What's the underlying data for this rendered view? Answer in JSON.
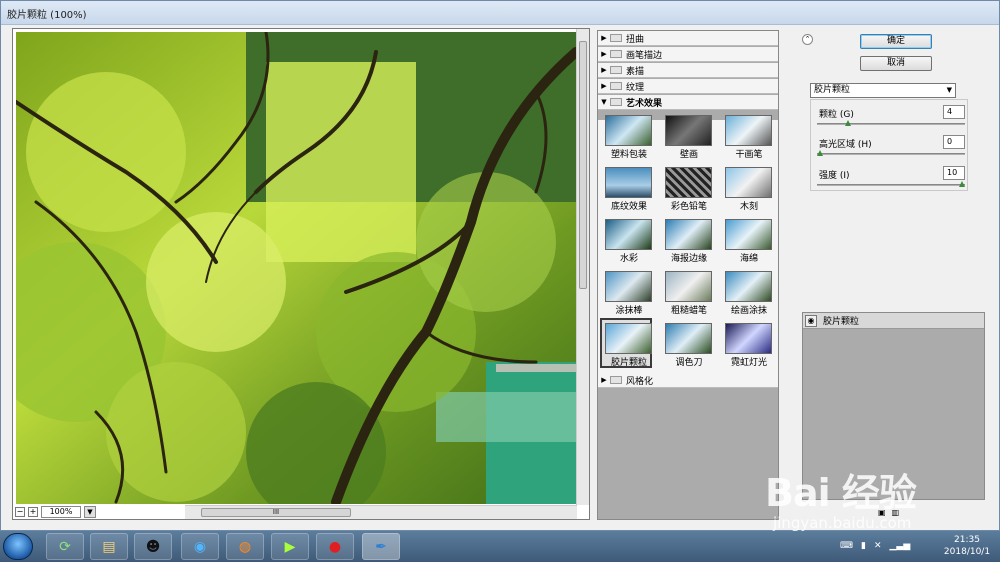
{
  "window": {
    "title": "胶片颗粒 (100%)"
  },
  "preview": {
    "zoom": "100%",
    "zoom_out": "−",
    "zoom_in": "+",
    "hscroll_label": "III"
  },
  "gallery": {
    "categories_top": [
      "扭曲",
      "画笔描边",
      "素描",
      "纹理"
    ],
    "open_category": "艺术效果",
    "categories_bottom": [
      "风格化"
    ],
    "filters": [
      "塑料包装",
      "壁画",
      "干画笔",
      "底纹效果",
      "彩色铅笔",
      "木刻",
      "水彩",
      "海报边缘",
      "海绵",
      "涂抹棒",
      "粗糙蜡笔",
      "绘画涂抹",
      "胶片颗粒",
      "调色刀",
      "霓虹灯光"
    ],
    "selected": "胶片颗粒"
  },
  "controls": {
    "ok_label": "确定",
    "cancel_label": "取消",
    "filter_select": "胶片颗粒",
    "params": [
      {
        "label": "颗粒 (G)",
        "value": "4",
        "fraction": 0.2
      },
      {
        "label": "高光区域 (H)",
        "value": "0",
        "fraction": 0.0
      },
      {
        "label": "强度 (I)",
        "value": "10",
        "fraction": 1.0
      }
    ]
  },
  "layers": {
    "items": [
      "胶片颗粒"
    ]
  },
  "taskbar": {
    "time": "21:35",
    "date": "2018/10/1"
  },
  "watermark": {
    "main": "Bai 经验",
    "sub": "jingyan.baidu.com"
  }
}
